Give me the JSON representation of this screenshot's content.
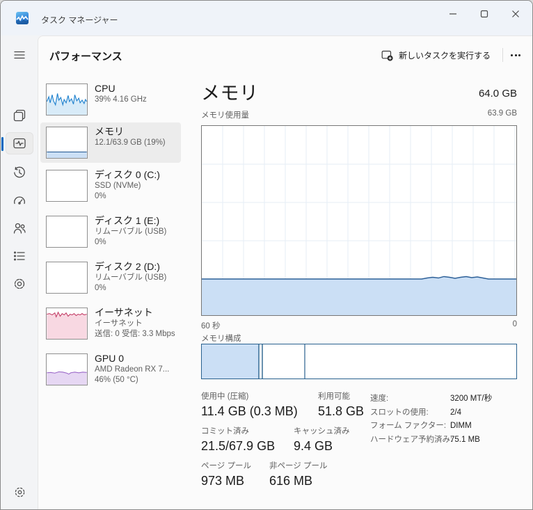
{
  "window": {
    "title": "タスク マネージャー"
  },
  "titlebar": {
    "controls": [
      "minimize-icon",
      "maximize-icon",
      "close-icon"
    ]
  },
  "nav": {
    "items": [
      {
        "icon": "processes-icon",
        "selected": false
      },
      {
        "icon": "performance-icon",
        "selected": true
      },
      {
        "icon": "app-history-icon",
        "selected": false
      },
      {
        "icon": "startup-apps-icon",
        "selected": false
      },
      {
        "icon": "users-icon",
        "selected": false
      },
      {
        "icon": "details-icon",
        "selected": false
      },
      {
        "icon": "services-icon",
        "selected": false
      }
    ],
    "settings_icon": "gear-icon"
  },
  "header": {
    "page_title": "パフォーマンス",
    "run_new_task_label": "新しいタスクを実行する",
    "more_icon": "ellipsis-icon"
  },
  "sidebar": {
    "items": [
      {
        "title": "CPU",
        "sub1": "39%  4.16 GHz",
        "sub2": ""
      },
      {
        "title": "メモリ",
        "sub1": "12.1/63.9 GB (19%)",
        "sub2": "",
        "selected": true
      },
      {
        "title": "ディスク 0 (C:)",
        "sub1": "SSD (NVMe)",
        "sub2": "0%"
      },
      {
        "title": "ディスク 1 (E:)",
        "sub1": "リムーバブル (USB)",
        "sub2": "0%"
      },
      {
        "title": "ディスク 2 (D:)",
        "sub1": "リムーバブル (USB)",
        "sub2": "0%"
      },
      {
        "title": "イーサネット",
        "sub1": "イーサネット",
        "sub2": "送信: 0 受信: 3.3 Mbps"
      },
      {
        "title": "GPU 0",
        "sub1": "AMD Radeon RX 7...",
        "sub2": "46% (50 °C)"
      }
    ]
  },
  "main": {
    "title": "メモリ",
    "total": "64.0 GB",
    "usage_label": "メモリ使用量",
    "usage_max": "63.9 GB",
    "time_left": "60 秒",
    "time_right": "0",
    "usage_percent": 19,
    "composition_label": "メモリ構成",
    "composition_segments_percent": [
      18,
      1.2,
      13.5,
      67.3
    ],
    "stats": {
      "row1": [
        {
          "label": "使用中 (圧縮)",
          "value": "11.4 GB (0.3 MB)"
        },
        {
          "label": "利用可能",
          "value": "51.8 GB"
        }
      ],
      "row2": [
        {
          "label": "コミット済み",
          "value": "21.5/67.9 GB"
        },
        {
          "label": "キャッシュ済み",
          "value": "9.4 GB"
        }
      ],
      "row3": [
        {
          "label": "ページ プール",
          "value": "973 MB"
        },
        {
          "label": "非ページ プール",
          "value": "616 MB"
        }
      ]
    },
    "details": [
      {
        "label": "速度:",
        "value": "3200 MT/秒"
      },
      {
        "label": "スロットの使用:",
        "value": "2/4"
      },
      {
        "label": "フォーム ファクター:",
        "value": "DIMM"
      },
      {
        "label": "ハードウェア予約済み:",
        "value": "75.1 MB"
      }
    ]
  },
  "colors": {
    "accent": "#0067c0",
    "memory_fill": "#cbdff5",
    "memory_line": "#2d6098",
    "cpu_line": "#2283cf",
    "ethernet_line": "#c23a63",
    "gpu_line": "#9a67c8"
  }
}
